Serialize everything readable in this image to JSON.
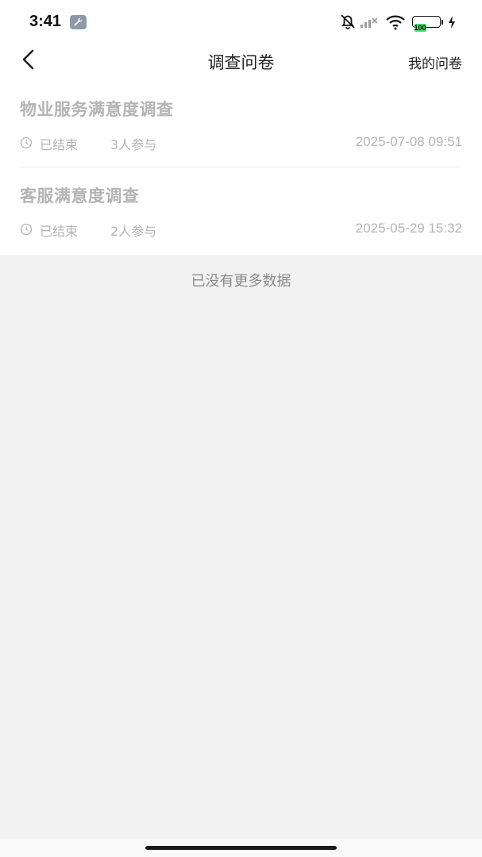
{
  "status_bar": {
    "time": "3:41",
    "battery": "100",
    "icons": [
      "wrench-icon",
      "bell-off-icon",
      "signal-icon",
      "wifi-icon",
      "battery-icon",
      "charging-icon"
    ]
  },
  "nav": {
    "title": "调查问卷",
    "right_label": "我的问卷",
    "back_icon": "chevron-left-icon"
  },
  "surveys": [
    {
      "title": "物业服务满意度调查",
      "status": "已结束",
      "participants": "3人参与",
      "date": "2025-07-08 09:51"
    },
    {
      "title": "客服满意度调查",
      "status": "已结束",
      "participants": "2人参与",
      "date": "2025-05-29 15:32"
    }
  ],
  "footer_text": "已没有更多数据",
  "colors": {
    "background": "#f2f2f2",
    "card": "#ffffff",
    "muted_text": "#b4b4b4",
    "battery_fill": "#4cd964"
  }
}
